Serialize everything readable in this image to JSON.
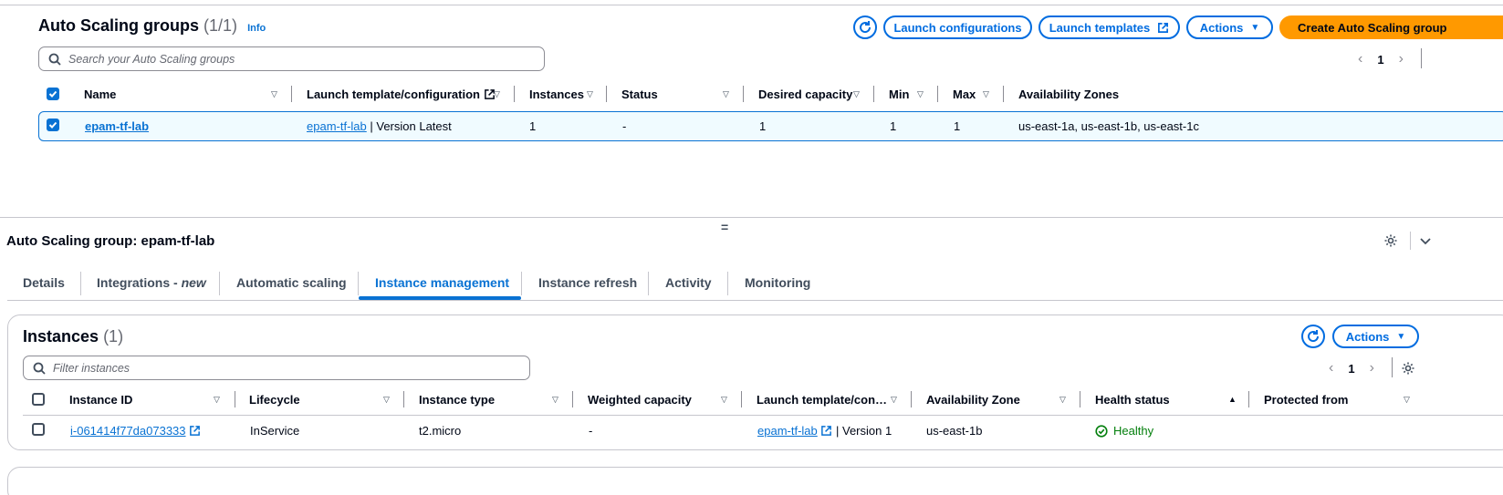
{
  "groups": {
    "title": "Auto Scaling groups",
    "count": "(1/1)",
    "info": "Info",
    "buttons": {
      "launch_configurations": "Launch configurations",
      "launch_templates": "Launch templates",
      "actions": "Actions",
      "create": "Create Auto Scaling group"
    },
    "search_placeholder": "Search your Auto Scaling groups",
    "page": "1",
    "columns": [
      "Name",
      "Launch template/configuration",
      "Instances",
      "Status",
      "Desired capacity",
      "Min",
      "Max",
      "Availability Zones"
    ],
    "row": {
      "name": "epam-tf-lab",
      "template_link": "epam-tf-lab",
      "template_suffix": "| Version Latest",
      "instances": "1",
      "status": "-",
      "desired": "1",
      "min": "1",
      "max": "1",
      "zones": "us-east-1a, us-east-1b, us-east-1c"
    }
  },
  "detail": {
    "title": "Auto Scaling group: epam-tf-lab",
    "tabs": {
      "details": "Details",
      "integrations": "Integrations - ",
      "integrations_new": "new",
      "automatic_scaling": "Automatic scaling",
      "instance_management": "Instance management",
      "instance_refresh": "Instance refresh",
      "activity": "Activity",
      "monitoring": "Monitoring"
    }
  },
  "instances": {
    "title": "Instances",
    "count": "(1)",
    "actions": "Actions",
    "search_placeholder": "Filter instances",
    "page": "1",
    "columns": [
      "Instance ID",
      "Lifecycle",
      "Instance type",
      "Weighted capacity",
      "Launch template/con…",
      "Availability Zone",
      "Health status",
      "Protected from"
    ],
    "row": {
      "id": "i-061414f77da073333",
      "lifecycle": "InService",
      "type": "t2.micro",
      "weighted": "-",
      "template_link": "epam-tf-lab",
      "template_suffix": "| Version 1",
      "zone": "us-east-1b",
      "health": "Healthy"
    }
  },
  "colors": {
    "accent": "#0972d3",
    "primary": "#ff9900",
    "healthy": "#037f0c"
  }
}
